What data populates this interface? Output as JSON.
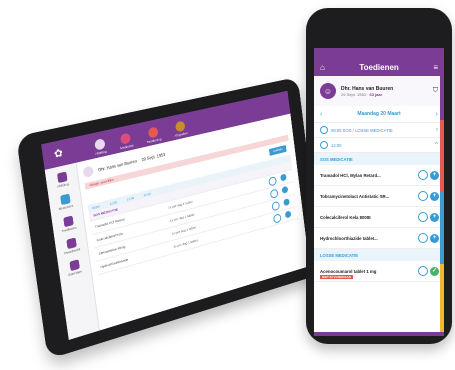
{
  "tablet": {
    "logo": "✿",
    "nav": [
      "Afdeling",
      "Bewoners",
      "Toedienen",
      "Overdracht",
      "Berichten"
    ],
    "tabs": [
      {
        "label": "Afdeling",
        "color": "#e9d9ef"
      },
      {
        "label": "Medicatie",
        "color": "#d84e7c"
      },
      {
        "label": "Toediening",
        "color": "#e45858"
      },
      {
        "label": "Afspraken",
        "color": "#c98c2a"
      }
    ],
    "patient": {
      "name": "Dhr. Hans van Buuren",
      "dob": "29 Sept. 1953"
    },
    "alert": "Allergie: penicilline",
    "button": "Opslaan",
    "header": [
      "08:00",
      "12:00",
      "17:00",
      "22:00"
    ],
    "section": "SOS MEDICATIE",
    "rows": [
      {
        "name": "Tramadol HCl Retard",
        "dose": "1x per dag 1 tablet"
      },
      {
        "name": "Colecalciferol Kela",
        "dose": "1x per dag 1 tablet"
      },
      {
        "name": "Simvastatine 40mg",
        "dose": "1x per dag 1 tablet"
      },
      {
        "name": "Hydrochloorthiazide",
        "dose": "1x per dag 1 tablet"
      }
    ]
  },
  "phone": {
    "title": "Toedienen",
    "menu_icon": "≡",
    "home_icon": "⌂",
    "patient": {
      "name": "Dhr. Hans van Buuren",
      "dob": "29 Sept. 1953",
      "age": "63 jaar",
      "avatar": "☺"
    },
    "shield_icon": "⛉",
    "date": "Maandag 20 Maart",
    "time_rows": [
      {
        "time": "08:00",
        "label": "SOS / LOSSE MEDICATIE",
        "right": "›"
      },
      {
        "time": "12:00",
        "label": "",
        "right": "^"
      }
    ],
    "sections": [
      {
        "title": "SOS MEDICATIE",
        "meds": [
          {
            "name": "Tramadol HCl, Mylan Retard...",
            "plus": "+"
          },
          {
            "name": "Tobramycinetolact Antistatic SR...",
            "plus": "+"
          },
          {
            "name": "Colecalciferol Kela 800IE",
            "plus": "+"
          },
          {
            "name": "Hydrochloorthiazide tablet...",
            "plus": "+"
          }
        ]
      },
      {
        "title": "LOSSE MEDICATIE",
        "meds": [
          {
            "name": "Acenocoumarol tablet 1 mg",
            "plus": "✓",
            "stock": "NIET IN VOORRAAD"
          }
        ]
      }
    ],
    "brand_colors": [
      "#7b3c96",
      "#e45858",
      "#3a9bd3",
      "#f2b632"
    ]
  }
}
